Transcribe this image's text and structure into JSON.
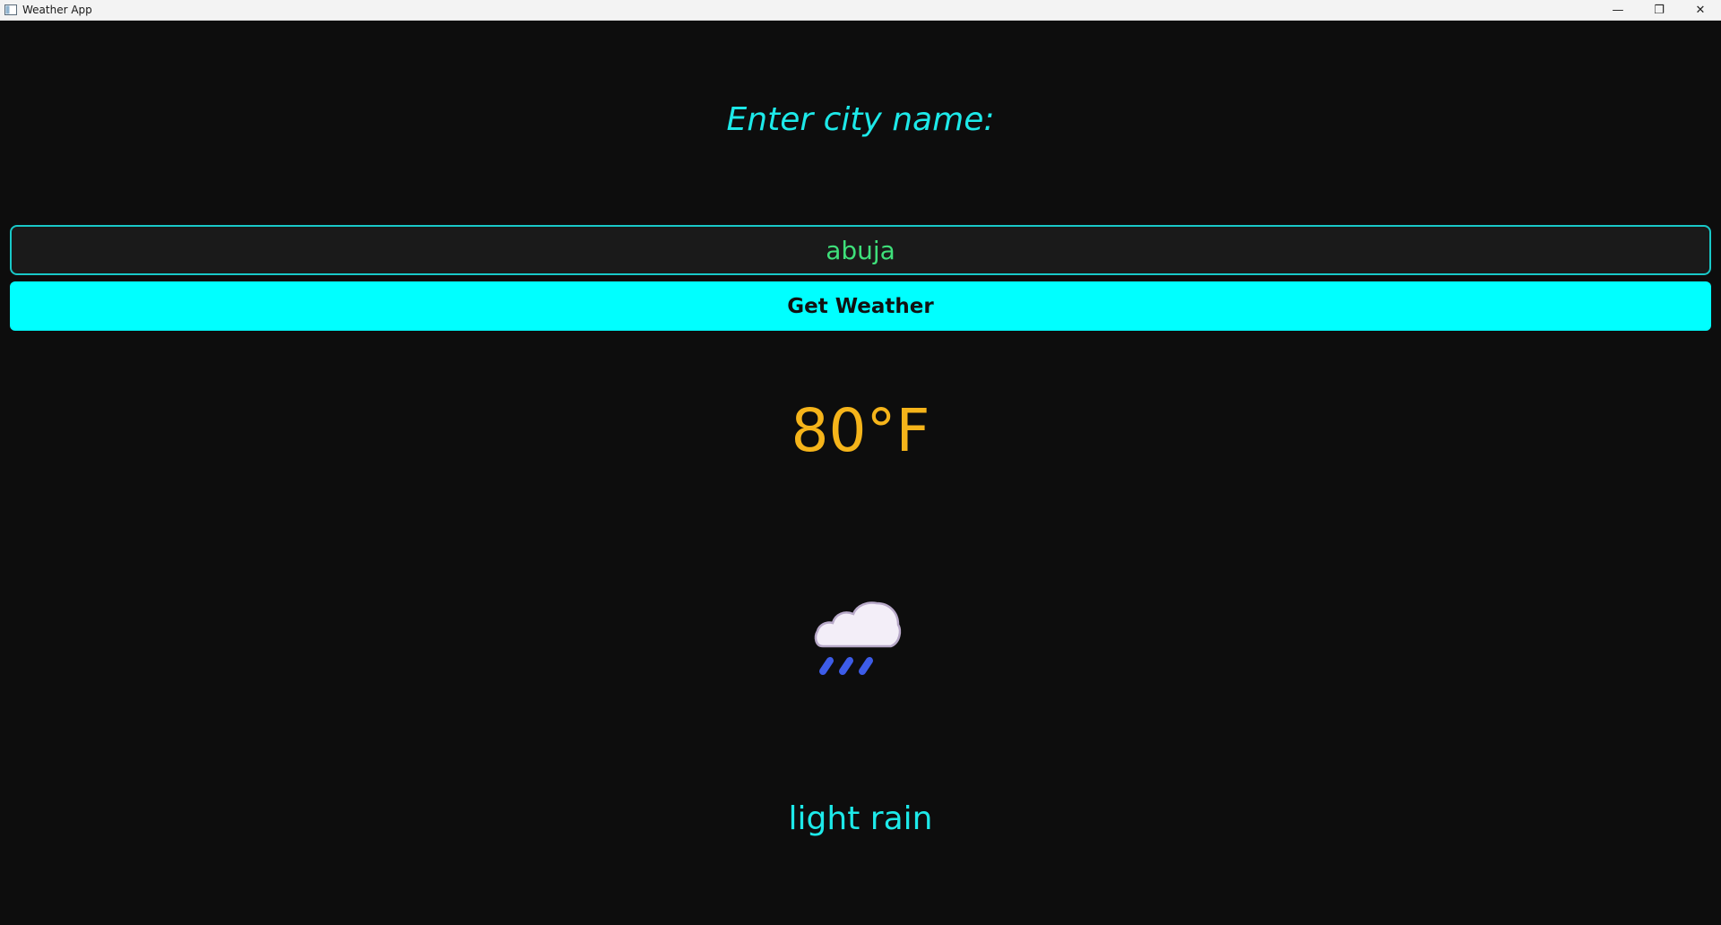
{
  "window": {
    "title": "Weather App",
    "minimize_glyph": "—",
    "restore_glyph": "❐",
    "close_glyph": "✕"
  },
  "prompt": {
    "label": "Enter city name:"
  },
  "search": {
    "value": "abuja"
  },
  "actions": {
    "get_weather_label": "Get Weather"
  },
  "weather": {
    "temperature": "80°F",
    "icon": "cloud-with-rain-icon",
    "description": "light rain"
  },
  "colors": {
    "background": "#0d0d0d",
    "accent_cyan": "#00ffff",
    "label_cyan": "#1de9e9",
    "input_text_green": "#3ee07a",
    "temperature_amber": "#f5b41a",
    "rain_blue": "#3d5ce8"
  }
}
